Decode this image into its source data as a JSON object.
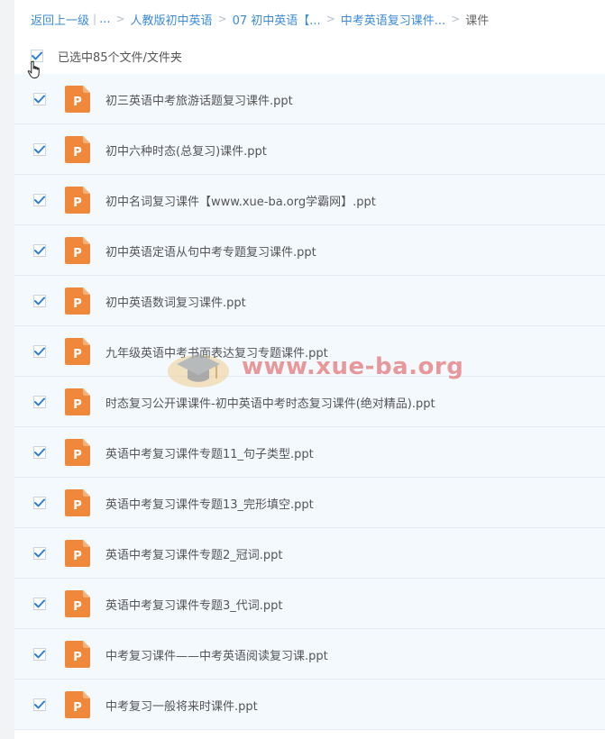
{
  "breadcrumb": {
    "back_label": "返回上一级",
    "ellipsis": "...",
    "items": [
      {
        "label": "人教版初中英语"
      },
      {
        "label": "07 初中英语【..."
      },
      {
        "label": "中考英语复习课件..."
      }
    ],
    "current": "课件",
    "separator": ">",
    "pipe": "|"
  },
  "selection": {
    "text": "已选中85个文件/文件夹",
    "checked": true
  },
  "files": [
    {
      "name": "初三英语中考旅游话题复习课件.ppt",
      "checked": true,
      "icon": "ppt-icon"
    },
    {
      "name": "初中六种时态(总复习)课件.ppt",
      "checked": true,
      "icon": "ppt-icon"
    },
    {
      "name": "初中名词复习课件【www.xue-ba.org学霸网】.ppt",
      "checked": true,
      "icon": "ppt-icon"
    },
    {
      "name": "初中英语定语从句中考专题复习课件.ppt",
      "checked": true,
      "icon": "ppt-icon"
    },
    {
      "name": "初中英语数词复习课件.ppt",
      "checked": true,
      "icon": "ppt-icon"
    },
    {
      "name": "九年级英语中考书面表达复习专题课件.ppt",
      "checked": true,
      "icon": "ppt-icon"
    },
    {
      "name": "时态复习公开课课件-初中英语中考时态复习课件(绝对精品).ppt",
      "checked": true,
      "icon": "ppt-icon"
    },
    {
      "name": "英语中考复习课件专题11_句子类型.ppt",
      "checked": true,
      "icon": "ppt-icon"
    },
    {
      "name": "英语中考复习课件专题13_完形填空.ppt",
      "checked": true,
      "icon": "ppt-icon"
    },
    {
      "name": "英语中考复习课件专题2_冠词.ppt",
      "checked": true,
      "icon": "ppt-icon"
    },
    {
      "name": "英语中考复习课件专题3_代词.ppt",
      "checked": true,
      "icon": "ppt-icon"
    },
    {
      "name": "中考复习课件——中考英语阅读复习课.ppt",
      "checked": true,
      "icon": "ppt-icon"
    },
    {
      "name": "中考复习一般将来时课件.ppt",
      "checked": true,
      "icon": "ppt-icon"
    }
  ],
  "watermark": {
    "text": "www.xue-ba.org"
  },
  "colors": {
    "link": "#3b8cd8",
    "check": "#2b7fd6",
    "ppt_icon": "#f0883c",
    "row_bg": "#f4f9fe",
    "watermark": "#e05c5c"
  }
}
